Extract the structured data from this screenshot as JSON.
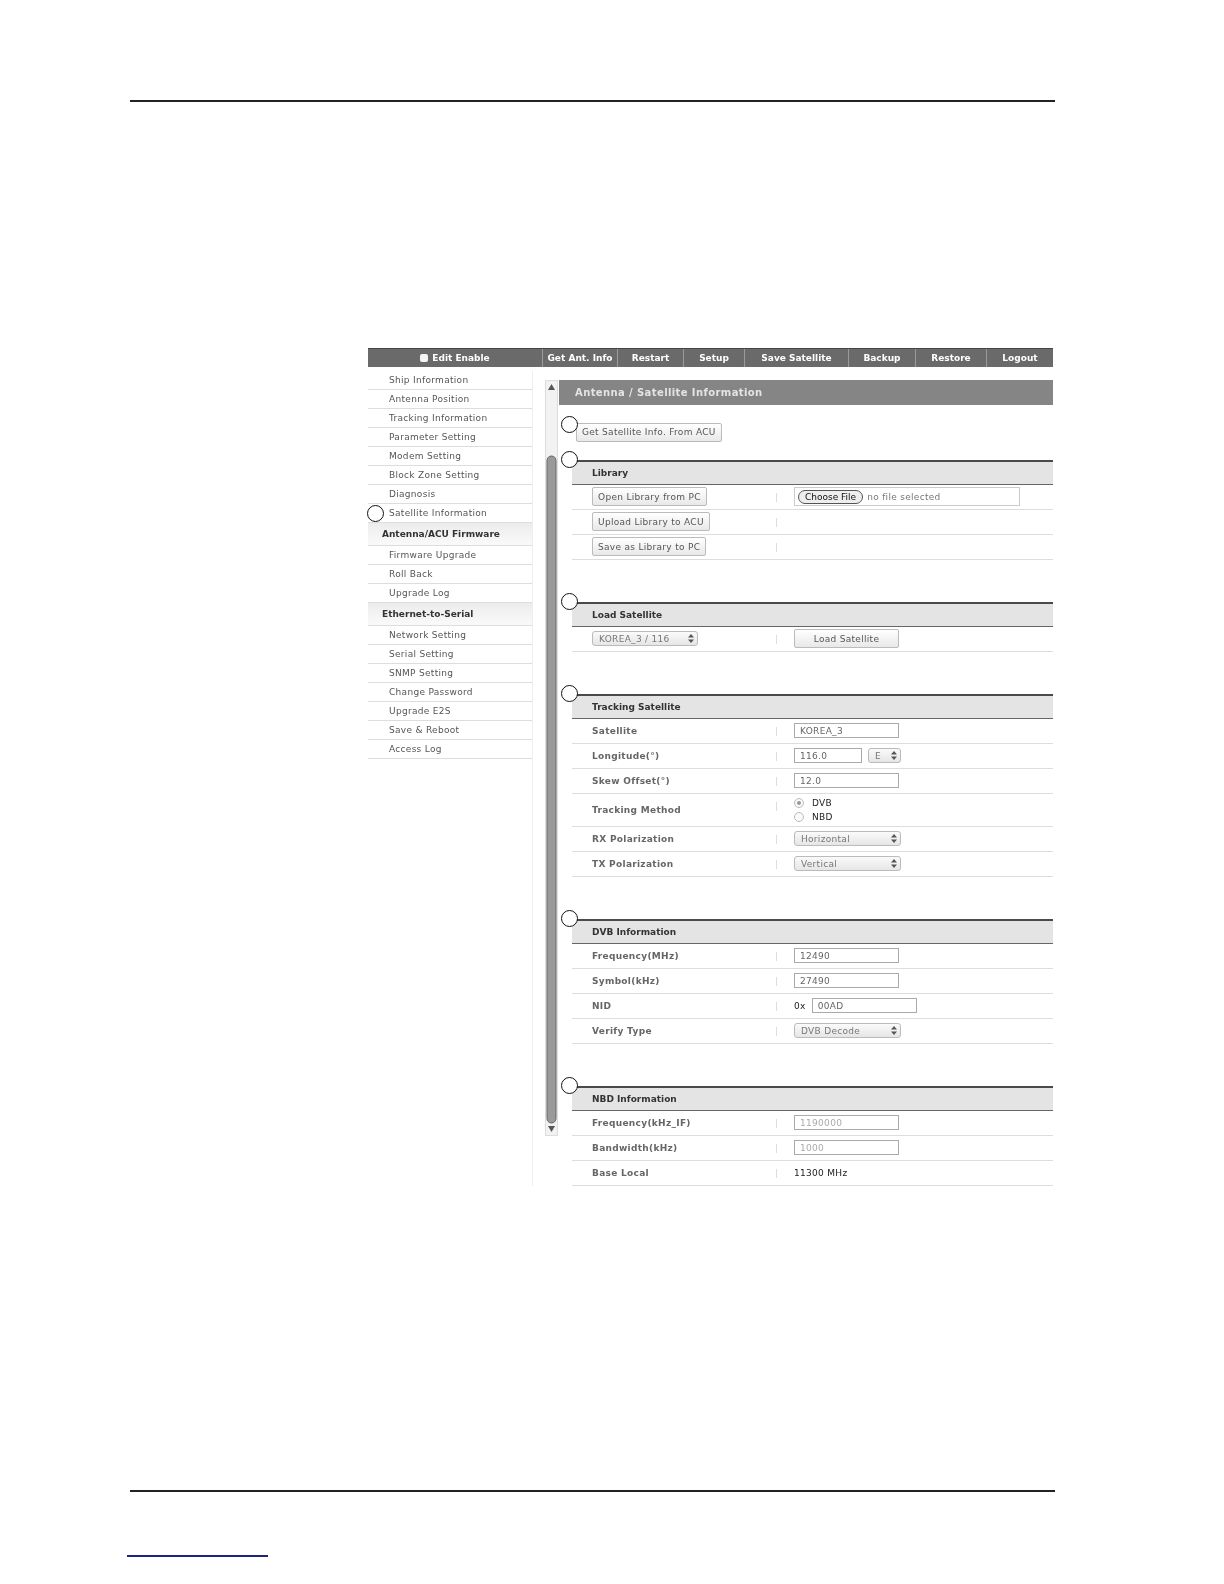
{
  "toolbar": {
    "items": [
      {
        "label": "Edit Enable",
        "kind": "checkbox",
        "checked": false
      },
      {
        "label": "Get Ant. Info",
        "kind": "button"
      },
      {
        "label": "Restart",
        "kind": "button"
      },
      {
        "label": "Setup",
        "kind": "button"
      },
      {
        "label": "Save Satellite",
        "kind": "button"
      },
      {
        "label": "Backup",
        "kind": "button"
      },
      {
        "label": "Restore",
        "kind": "button"
      },
      {
        "label": "Logout",
        "kind": "button"
      }
    ]
  },
  "sidebar": {
    "items": [
      {
        "label": "Ship Information",
        "kind": "item",
        "callout": false
      },
      {
        "label": "Antenna Position",
        "kind": "item",
        "callout": false
      },
      {
        "label": "Tracking Information",
        "kind": "item",
        "callout": false
      },
      {
        "label": "Parameter Setting",
        "kind": "item",
        "callout": false
      },
      {
        "label": "Modem Setting",
        "kind": "item",
        "callout": false
      },
      {
        "label": "Block Zone Setting",
        "kind": "item",
        "callout": false
      },
      {
        "label": "Diagnosis",
        "kind": "item",
        "callout": false
      },
      {
        "label": "Satellite Information",
        "kind": "item",
        "callout": true
      },
      {
        "label": "Antenna/ACU Firmware",
        "kind": "heading",
        "callout": false
      },
      {
        "label": "Firmware Upgrade",
        "kind": "item",
        "callout": false
      },
      {
        "label": "Roll Back",
        "kind": "item",
        "callout": false
      },
      {
        "label": "Upgrade Log",
        "kind": "item",
        "callout": false
      },
      {
        "label": "Ethernet-to-Serial",
        "kind": "heading",
        "callout": false
      },
      {
        "label": "Network Setting",
        "kind": "item",
        "callout": false
      },
      {
        "label": "Serial Setting",
        "kind": "item",
        "callout": false
      },
      {
        "label": "SNMP Setting",
        "kind": "item",
        "callout": false
      },
      {
        "label": "Change Password",
        "kind": "item",
        "callout": false
      },
      {
        "label": "Upgrade E2S",
        "kind": "item",
        "callout": false
      },
      {
        "label": "Save & Reboot",
        "kind": "item",
        "callout": false
      },
      {
        "label": "Access Log",
        "kind": "item",
        "callout": false
      }
    ]
  },
  "content": {
    "title": "Antenna / Satellite Information",
    "action_button": {
      "label": "Get Satellite Info. From ACU",
      "callout": true
    },
    "sections": [
      {
        "title": "Library",
        "callout": true,
        "rows": [
          {
            "label": {
              "kind": "button",
              "text": "Open Library from PC"
            },
            "value": {
              "kind": "file",
              "button": "Choose File",
              "text": "no file selected"
            }
          },
          {
            "label": {
              "kind": "button",
              "text": "Upload Library to ACU"
            },
            "value": {
              "kind": "empty"
            }
          },
          {
            "label": {
              "kind": "button",
              "text": "Save as Library to PC"
            },
            "value": {
              "kind": "empty"
            }
          }
        ]
      },
      {
        "title": "Load Satellite",
        "callout": true,
        "rows": [
          {
            "label": {
              "kind": "select",
              "text": "KOREA_3 / 116"
            },
            "value": {
              "kind": "button",
              "text": "Load Satellite"
            }
          }
        ]
      },
      {
        "title": "Tracking Satellite",
        "callout": true,
        "rows": [
          {
            "label": {
              "kind": "text",
              "text": "Satellite"
            },
            "value": {
              "kind": "input",
              "text": "KOREA_3",
              "disabled": false
            }
          },
          {
            "label": {
              "kind": "text",
              "text": "Longitude(°)"
            },
            "value": {
              "kind": "input_select",
              "text": "116.0",
              "option": "E"
            }
          },
          {
            "label": {
              "kind": "text",
              "text": "Skew Offset(°)"
            },
            "value": {
              "kind": "input",
              "text": "12.0",
              "disabled": false
            }
          },
          {
            "label": {
              "kind": "text",
              "text": "Tracking Method"
            },
            "value": {
              "kind": "radio",
              "options": [
                {
                  "label": "DVB",
                  "selected": true
                },
                {
                  "label": "NBD",
                  "selected": false
                }
              ]
            }
          },
          {
            "label": {
              "kind": "text",
              "text": "RX Polarization"
            },
            "value": {
              "kind": "select",
              "text": "Horizontal"
            }
          },
          {
            "label": {
              "kind": "text",
              "text": "TX Polarization"
            },
            "value": {
              "kind": "select",
              "text": "Vertical"
            }
          }
        ]
      },
      {
        "title": "DVB Information",
        "callout": true,
        "rows": [
          {
            "label": {
              "kind": "text",
              "text": "Frequency(MHz)"
            },
            "value": {
              "kind": "input",
              "text": "12490",
              "disabled": false
            }
          },
          {
            "label": {
              "kind": "text",
              "text": "Symbol(kHz)"
            },
            "value": {
              "kind": "input",
              "text": "27490",
              "disabled": false
            }
          },
          {
            "label": {
              "kind": "text",
              "text": "NID"
            },
            "value": {
              "kind": "prefixed_input",
              "prefix": "0x",
              "text": "00AD"
            }
          },
          {
            "label": {
              "kind": "text",
              "text": "Verify Type"
            },
            "value": {
              "kind": "select",
              "text": "DVB Decode"
            }
          }
        ]
      },
      {
        "title": "NBD Information",
        "callout": true,
        "rows": [
          {
            "label": {
              "kind": "text",
              "text": "Frequency(kHz_IF)"
            },
            "value": {
              "kind": "input",
              "text": "1190000",
              "disabled": true
            }
          },
          {
            "label": {
              "kind": "text",
              "text": "Bandwidth(kHz)"
            },
            "value": {
              "kind": "input",
              "text": "1000",
              "disabled": true
            }
          },
          {
            "label": {
              "kind": "text",
              "text": "Base Local"
            },
            "value": {
              "kind": "text",
              "text": "11300 MHz"
            }
          }
        ]
      }
    ]
  }
}
